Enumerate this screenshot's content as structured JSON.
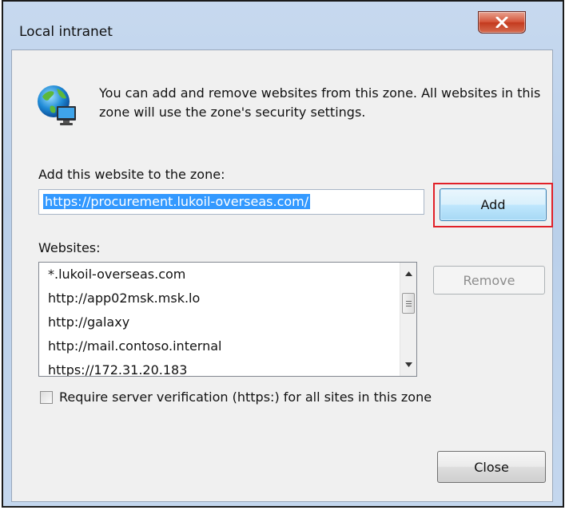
{
  "window": {
    "title": "Local intranet",
    "close_icon": "close-x-icon"
  },
  "info": {
    "icon": "globe-computer-icon",
    "text": "You can add and remove websites from this zone. All websites in this zone will use the zone's security settings."
  },
  "add_section": {
    "label": "Add this website to the zone:",
    "url_value": "https://procurement.lukoil-overseas.com/",
    "add_button": "Add",
    "highlight_color": "#e12028"
  },
  "websites": {
    "label": "Websites:",
    "items": [
      "*.lukoil-overseas.com",
      "http://app02msk.msk.lo",
      "http://galaxy",
      "http://mail.contoso.internal",
      "https://172.31.20.183"
    ],
    "remove_button": "Remove"
  },
  "verification": {
    "label": "Require server verification (https:) for all sites in this zone",
    "checked": false
  },
  "close_button": "Close"
}
